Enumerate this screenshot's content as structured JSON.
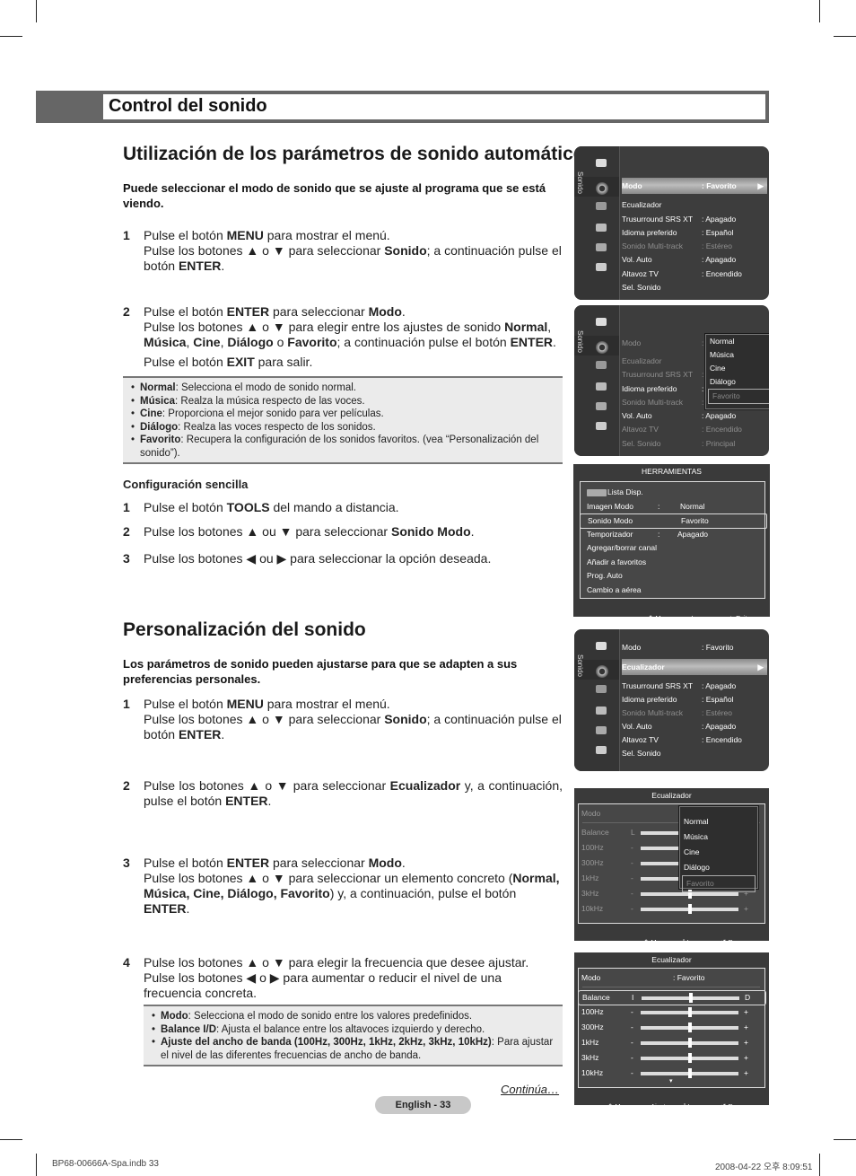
{
  "header": {
    "title": "Control del sonido"
  },
  "section1": {
    "heading": "Utilización de los parámetros de sonido automáticos",
    "lead": "Puede seleccionar el modo de sonido que se ajuste al programa que se está viendo.",
    "steps": [
      {
        "num": "1",
        "html": "Pulse el botón <b>MENU</b> para mostrar el menú.<br>Pulse los botones ▲ o ▼ para seleccionar <b>Sonido</b>; a continuación pulse el botón <b>ENTER</b>."
      },
      {
        "num": "2",
        "html": "Pulse el botón <b>ENTER</b> para seleccionar <b>Modo</b>.<br>Pulse los botones ▲ o ▼ para elegir entre los ajustes de sonido <b>Normal</b>, <b>Música</b>, <b>Cine</b>, <b>Diálogo</b> o <b>Favorito</b>; a continuación pulse el botón <b>ENTER</b>.<div style='margin-top:5px'>Pulse el botón <b>EXIT</b> para salir.</div>"
      }
    ],
    "notes": [
      {
        "term": "Normal",
        "text": ": Selecciona el modo de sonido normal."
      },
      {
        "term": "Música",
        "text": ": Realza la música respecto de las voces."
      },
      {
        "term": "Cine",
        "text": ": Proporciona el mejor sonido para ver películas."
      },
      {
        "term": "Diálogo",
        "text": ": Realza las voces respecto de los sonidos."
      },
      {
        "term": "Favorito",
        "text": ": Recupera la configuración de los sonidos favoritos. (vea “Personalización del sonido”)."
      }
    ],
    "easy": {
      "heading": "Configuración sencilla",
      "steps": [
        {
          "num": "1",
          "html": "Pulse el botón <b>TOOLS</b> del mando a distancia."
        },
        {
          "num": "2",
          "html": "Pulse los botones ▲ ou ▼ para seleccionar <b>Sonido Modo</b>."
        },
        {
          "num": "3",
          "html": "Pulse los botones ◀ ou ▶ para seleccionar la opción deseada."
        }
      ]
    }
  },
  "section2": {
    "heading": "Personalización del sonido",
    "lead": "Los parámetros de sonido pueden ajustarse para que se adapten a sus preferencias personales.",
    "steps": [
      {
        "num": "1",
        "html": "Pulse el botón <b>MENU</b> para mostrar el menú.<br>Pulse los botones ▲ o ▼ para seleccionar <b>Sonido</b>; a continuación pulse el botón <b>ENTER</b>."
      },
      {
        "num": "2",
        "html": "Pulse los botones ▲ o ▼ para seleccionar <b>Ecualizador</b> y, a continuación, pulse el botón <b>ENTER</b>."
      },
      {
        "num": "3",
        "html": "Pulse el botón <b>ENTER</b> para seleccionar <b>Modo</b>.<br>Pulse los botones ▲ o ▼ para seleccionar un elemento concreto (<b>Normal, Música, Cine, Diálogo, Favorito</b>) y, a continuación, pulse el botón <b>ENTER</b>."
      },
      {
        "num": "4",
        "html": "Pulse los botones ▲ o ▼ para elegir la frecuencia que desee ajustar.<br>Pulse los botones ◀ o ▶ para aumentar o reducir el nivel de una frecuencia concreta."
      }
    ],
    "notes": [
      {
        "term": "Modo",
        "text": ": Selecciona el modo de sonido entre los valores predefinidos."
      },
      {
        "term": "Balance I/D",
        "text": ": Ajusta el balance entre los altavoces izquierdo y derecho."
      },
      {
        "term": "Ajuste del ancho de banda (100Hz, 300Hz, 1kHz, 2kHz, 3kHz, 10kHz)",
        "text": ": Para ajustar el nivel de las diferentes frecuencias de ancho de banda."
      }
    ],
    "continues": "Continúa…"
  },
  "osd_sound_menu": {
    "side_label": "Sonido",
    "rows": [
      {
        "label": "Modo",
        "value": ": Favorito"
      },
      {
        "label": "Ecualizador",
        "value": ""
      },
      {
        "label": "Trusurround SRS XT",
        "value": ": Apagado"
      },
      {
        "label": "Idioma preferido",
        "value": ": Español"
      },
      {
        "label": "Sonido Multi-track",
        "value": ": Estéreo"
      },
      {
        "label": "Vol. Auto",
        "value": ": Apagado"
      },
      {
        "label": "Altavoz TV",
        "value": ": Encendido"
      },
      {
        "label": "Sel. Sonido",
        "value": ""
      }
    ],
    "sel_val_screen3": ": Principal"
  },
  "mode_options": [
    "Normal",
    "Música",
    "Cine",
    "Diálogo",
    "Favorito"
  ],
  "tools_menu": {
    "title": "HERRAMIENTAS",
    "rows": [
      {
        "label": "Lista Disp.",
        "sep": "",
        "value": ""
      },
      {
        "label": "Imagen Modo",
        "sep": ":",
        "value": "Normal"
      },
      {
        "label": "Sonido Modo",
        "sep": "",
        "value": "Favorito"
      },
      {
        "label": "Temporizador",
        "sep": ":",
        "value": "Apagado"
      },
      {
        "label": "Agregar/borrar canal",
        "sep": "",
        "value": ""
      },
      {
        "label": "Añadir a favoritos",
        "sep": "",
        "value": ""
      },
      {
        "label": "Prog. Auto",
        "sep": "",
        "value": ""
      },
      {
        "label": "Cambio a aérea",
        "sep": "",
        "value": ""
      }
    ],
    "footer": {
      "move": "Mover",
      "enter": "Ingresar",
      "exit": "Exit"
    }
  },
  "equalizer": {
    "title": "Ecualizador",
    "mode_label": "Modo",
    "mode_value": ": Favorito",
    "bands": [
      {
        "label": "Balance",
        "min": "I",
        "max": "D",
        "level": 0.5
      },
      {
        "label": "100Hz",
        "min": "-",
        "max": "+",
        "level": 0.5
      },
      {
        "label": "300Hz",
        "min": "-",
        "max": "+",
        "level": 0.5
      },
      {
        "label": "1kHz",
        "min": "-",
        "max": "+",
        "level": 0.5
      },
      {
        "label": "3kHz",
        "min": "-",
        "max": "+",
        "level": 0.5
      },
      {
        "label": "10kHz",
        "min": "-",
        "max": "+",
        "level": 0.5
      }
    ],
    "balance_min_popup": "L",
    "footer": {
      "move": "Mover",
      "adjust": "Ajustar",
      "enter": "Ingresar",
      "back": "Regresar"
    }
  },
  "footer": {
    "page_label": "English - 33",
    "file": "BP68-00666A-Spa.indb   33",
    "date": "2008-04-22   오후 8:09:51"
  }
}
